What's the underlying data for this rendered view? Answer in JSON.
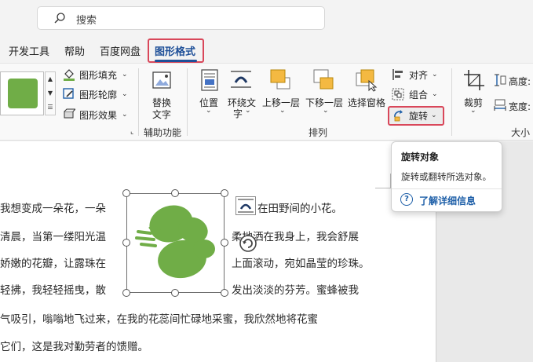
{
  "search": {
    "placeholder": "搜索"
  },
  "tabs": [
    {
      "label": "开发工具"
    },
    {
      "label": "帮助"
    },
    {
      "label": "百度网盘"
    },
    {
      "label": "图形格式",
      "active": true
    }
  ],
  "ribbon": {
    "shape_styles": {
      "fill": "图形填充",
      "outline": "图形轮廓",
      "effects": "图形效果"
    },
    "accessibility": {
      "alt_text": [
        "替换",
        "文字"
      ],
      "group_label": "辅助功能"
    },
    "arrange": {
      "position": "位置",
      "wrap_text": [
        "环绕文",
        "字"
      ],
      "bring_forward": "上移一层",
      "send_backward": "下移一层",
      "selection_pane": "选择窗格",
      "align": "对齐",
      "group": "组合",
      "rotate": "旋转",
      "group_label": "排列"
    },
    "size": {
      "crop": "裁剪",
      "height": "高度:",
      "width": "宽度:",
      "group_label": "大小"
    }
  },
  "tooltip": {
    "title": "旋转对象",
    "description": "旋转或翻转所选对象。",
    "link": "了解详细信息"
  },
  "document": {
    "lines": [
      {
        "left": "我想变成一朵花，一朵",
        "right": "在田野间的小花。"
      },
      {
        "left": "清晨，当第一缕阳光温",
        "right": "柔地洒在我身上，我会舒展"
      },
      {
        "left": "娇嫩的花瓣，让露珠在",
        "right": "上面滚动，宛如晶莹的珍珠。"
      },
      {
        "left": "轻拂，我轻轻摇曳，散",
        "right": "发出淡淡的芬芳。蜜蜂被我"
      },
      {
        "full": "气吸引，嗡嗡地飞过来，在我的花蕊间忙碌地采蜜，我欣然地将花蜜"
      },
      {
        "full": "它们，这是我对勤劳者的馈赠。"
      }
    ]
  },
  "colors": {
    "accent": "#1e4f98",
    "highlight_border": "#d9475a",
    "shape_green": "#70ad47"
  }
}
